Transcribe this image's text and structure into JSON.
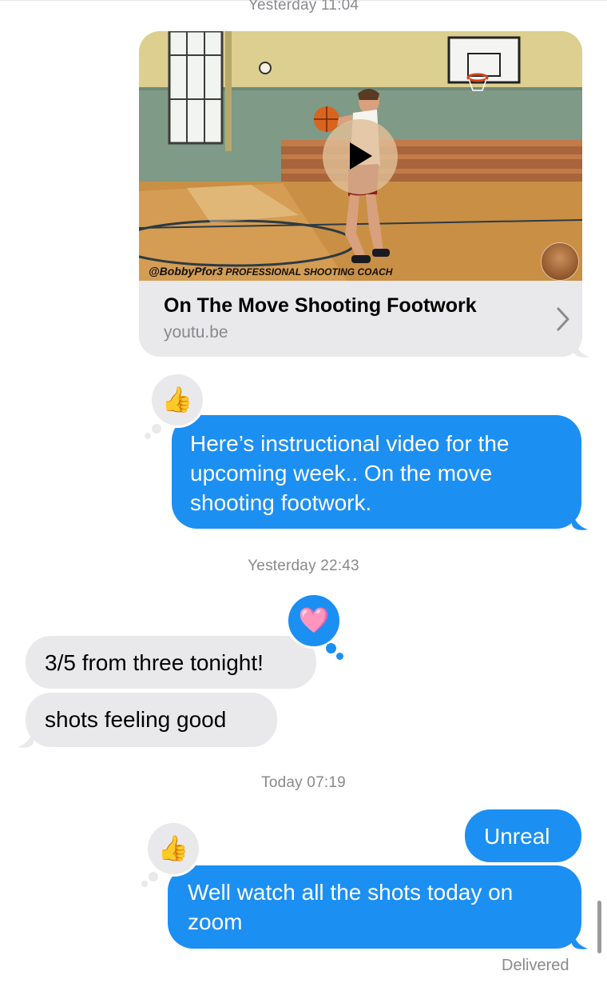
{
  "timestamps": [
    "Yesterday 11:04",
    "Yesterday 22:43",
    "Today 07:19"
  ],
  "link_preview": {
    "title": "On The Move Shooting Footwork",
    "domain": "youtu.be",
    "watermark_handle": "@BobbyPfor3",
    "watermark_caption": "PROFESSIONAL SHOOTING COACH",
    "play_icon": "play-icon",
    "chevron_icon": "chevron-right-icon"
  },
  "messages": [
    {
      "sender": "me",
      "text": "Here’s instructional video for the upcoming week.. On the move shooting footwork.",
      "reaction": "👍"
    },
    {
      "sender": "them",
      "text": "3/5 from three tonight!",
      "reaction": "🩷"
    },
    {
      "sender": "them",
      "text": "shots feeling good"
    },
    {
      "sender": "me",
      "text": "Unreal"
    },
    {
      "sender": "me",
      "text": "Well watch all the shots today on zoom",
      "reaction": "👍"
    }
  ],
  "status": "Delivered",
  "colors": {
    "blue_bubble": "#1c8ff3",
    "gray_bubble": "#e9e9eb",
    "timestamp": "#8a8a8e"
  }
}
